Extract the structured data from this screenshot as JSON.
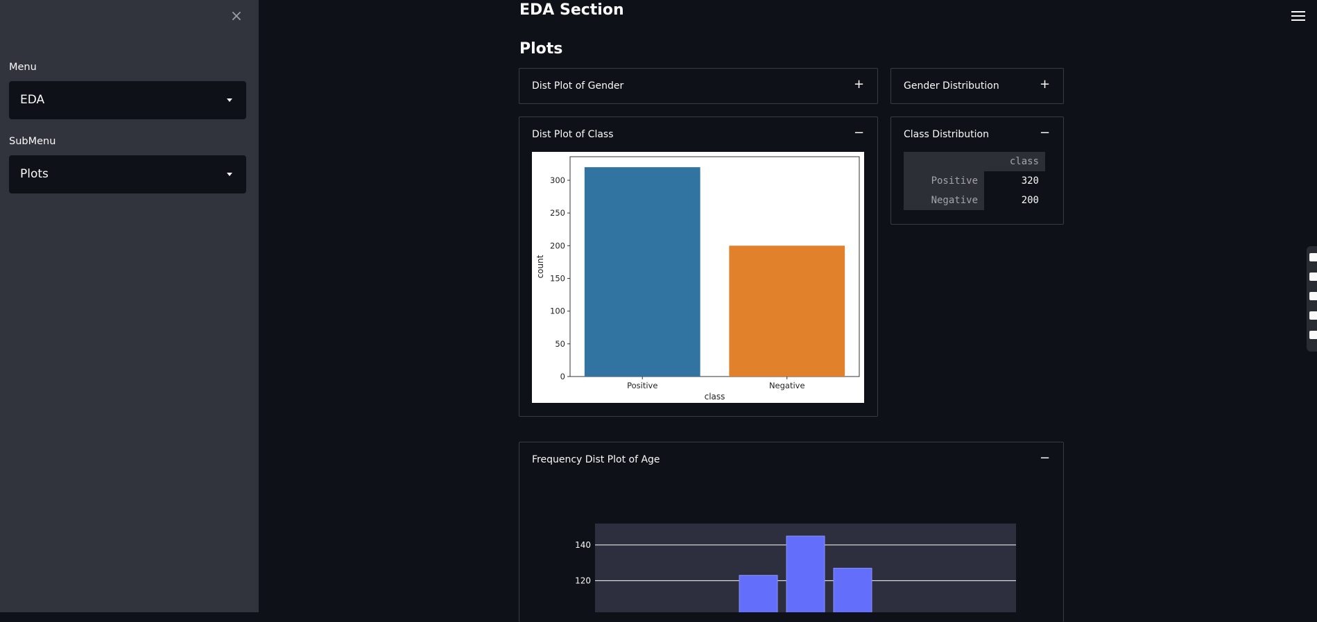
{
  "sidebar": {
    "close_icon": "×",
    "menu_label": "Menu",
    "menu_value": "EDA",
    "submenu_label": "SubMenu",
    "submenu_value": "Plots"
  },
  "main": {
    "title": "EDA Section",
    "subtitle": "Plots",
    "expanders": {
      "gender_dist_plot": {
        "title": "Dist Plot of Gender",
        "sign": "+"
      },
      "gender_distribution": {
        "title": "Gender Distribution",
        "sign": "+"
      },
      "class_dist_plot": {
        "title": "Dist Plot of Class",
        "sign": "−"
      },
      "class_distribution": {
        "title": "Class Distribution",
        "sign": "−"
      },
      "age_freq_plot": {
        "title": "Frequency Dist Plot of Age",
        "sign": "−"
      }
    },
    "class_table": {
      "column": "class",
      "rows": [
        {
          "index": "Positive",
          "value": "320"
        },
        {
          "index": "Negative",
          "value": "200"
        }
      ]
    }
  },
  "chart_data": [
    {
      "type": "bar",
      "categories": [
        "Positive",
        "Negative"
      ],
      "values": [
        320,
        200
      ],
      "colors": [
        "#3274a1",
        "#e1812c"
      ],
      "title": "",
      "xlabel": "class",
      "ylabel": "count",
      "ylim": [
        0,
        336
      ],
      "yticks": [
        0,
        50,
        100,
        150,
        200,
        250,
        300
      ]
    },
    {
      "type": "bar",
      "title": "",
      "values": [
        123,
        145,
        127
      ],
      "color": "#636efa",
      "ylim": [
        86,
        152
      ],
      "yticks": [
        100,
        120,
        140
      ],
      "background": "#2d2f3e"
    }
  ]
}
